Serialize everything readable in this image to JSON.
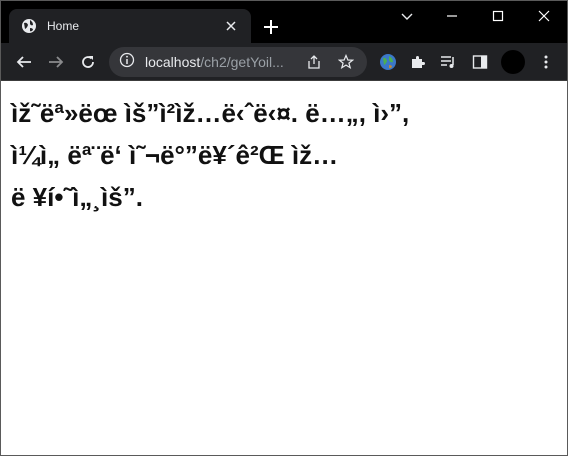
{
  "tab": {
    "title": "Home",
    "favicon": "globe-icon",
    "close_icon": "close-icon"
  },
  "window_controls": [
    "chevron-down-icon",
    "minimize-icon",
    "maximize-icon",
    "close-icon"
  ],
  "toolbar": {
    "back_icon": "arrow-left-icon",
    "forward_icon": "arrow-right-icon",
    "reload_icon": "reload-icon",
    "site_info_icon": "info-icon",
    "url_host": "localhost",
    "url_path": "/ch2/getYoil...",
    "share_icon": "share-icon",
    "bookmark_icon": "star-icon",
    "extensions": [
      "globe-extension-icon",
      "puzzle-icon",
      "media-control-icon",
      "side-panel-icon"
    ],
    "menu_icon": "kebab-menu-icon"
  },
  "page": {
    "lines": [
      "ìž˜ëª»ëœ ìš”ì²­ìž…ë‹ˆë‹¤. ë…„, ì›”,",
      "ì¼ì„ ëª¨ë‘ ì˜¬ë°”ë¥´ê²Œ ìž…",
      "ë ¥í•˜ì„¸ìš”."
    ]
  },
  "colors": {
    "tabstrip_bg": "#000000",
    "tab_bg": "#202124",
    "toolbar_bg": "#202124",
    "omnibox_bg": "#35363a",
    "page_bg": "#ffffff",
    "text": "#111111"
  }
}
